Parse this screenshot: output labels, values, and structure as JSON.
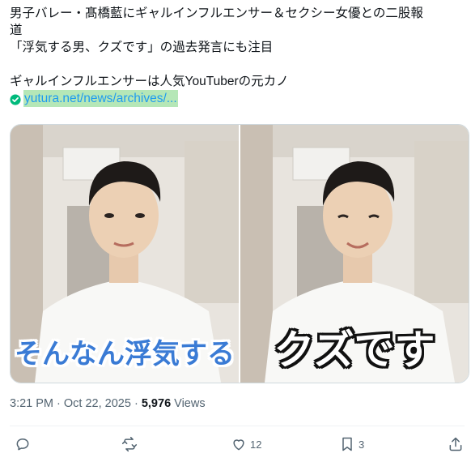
{
  "post": {
    "lines": [
      "男子バレー・髙橋藍にギャルインフルエンサー＆セクシー女優との二股報",
      "道",
      "「浮気する男、クズです」の過去発言にも注目",
      "",
      "ギャルインフルエンサーは人気YouTuberの元カノ"
    ],
    "link_text": "yutura.net/news/archives/..."
  },
  "media": {
    "left_caption": "そんなん浮気する",
    "right_caption": "クズです"
  },
  "meta": {
    "time": "3:21 PM",
    "date": "Oct 22, 2025",
    "separator": "·",
    "views_count": "5,976",
    "views_label": "Views"
  },
  "actions": {
    "reply_count": "",
    "repost_count": "",
    "like_count": "12",
    "bookmark_count": "3"
  },
  "icons": [
    "check-circle-icon",
    "reply-icon",
    "repost-icon",
    "like-icon",
    "bookmark-icon",
    "share-icon"
  ],
  "colors": {
    "link": "#1d9bf0",
    "link_highlight": "#b5e7b7",
    "check": "#00ba7c",
    "muted": "#536471"
  }
}
